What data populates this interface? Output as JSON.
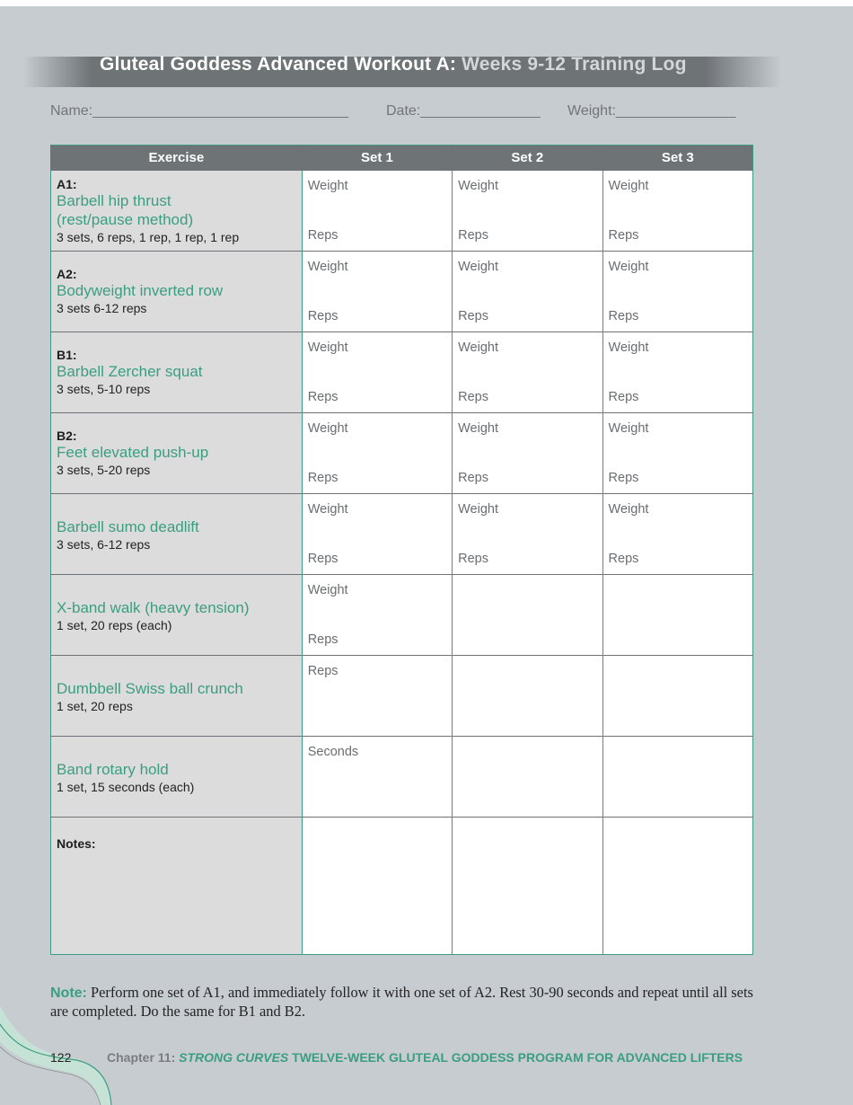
{
  "header": {
    "title_bold": "Gluteal Goddess Advanced",
    "title_mid": " Workout A:",
    "title_light": " Weeks 9-12 Training Log"
  },
  "fields": {
    "name": "Name:________________________________",
    "date": "Date:_______________",
    "weight": "Weight:_______________"
  },
  "table": {
    "headers": [
      "Exercise",
      "Set 1",
      "Set 2",
      "Set 3"
    ],
    "rows": [
      {
        "code": "A1:",
        "name": "Barbell hip thrust (rest/pause method)",
        "scheme": "3 sets, 6 reps, 1 rep, 1 rep, 1 rep",
        "cells": [
          {
            "top": "Weight",
            "bottom": "Reps"
          },
          {
            "top": "Weight",
            "bottom": "Reps"
          },
          {
            "top": "Weight",
            "bottom": "Reps"
          }
        ]
      },
      {
        "code": "A2:",
        "name": "Bodyweight inverted row",
        "scheme": "3 sets 6-12 reps",
        "cells": [
          {
            "top": "Weight",
            "bottom": "Reps"
          },
          {
            "top": "Weight",
            "bottom": "Reps"
          },
          {
            "top": "Weight",
            "bottom": "Reps"
          }
        ]
      },
      {
        "code": "B1:",
        "name": "Barbell Zercher squat",
        "scheme": "3 sets, 5-10 reps",
        "cells": [
          {
            "top": "Weight",
            "bottom": "Reps"
          },
          {
            "top": "Weight",
            "bottom": "Reps"
          },
          {
            "top": "Weight",
            "bottom": "Reps"
          }
        ]
      },
      {
        "code": "B2:",
        "name": "Feet elevated push-up",
        "scheme": "3 sets, 5-20 reps",
        "cells": [
          {
            "top": "Weight",
            "bottom": "Reps"
          },
          {
            "top": "Weight",
            "bottom": "Reps"
          },
          {
            "top": "Weight",
            "bottom": "Reps"
          }
        ]
      },
      {
        "code": "",
        "name": "Barbell sumo deadlift",
        "scheme": "3 sets, 6-12 reps",
        "cells": [
          {
            "top": "Weight",
            "bottom": "Reps"
          },
          {
            "top": "Weight",
            "bottom": "Reps"
          },
          {
            "top": "Weight",
            "bottom": "Reps"
          }
        ]
      },
      {
        "code": "",
        "name": "X-band walk (heavy tension)",
        "scheme": "1 set, 20 reps (each)",
        "cells": [
          {
            "top": "Weight",
            "bottom": "Reps"
          },
          {
            "top": "",
            "bottom": ""
          },
          {
            "top": "",
            "bottom": ""
          }
        ]
      },
      {
        "code": "",
        "name": "Dumbbell Swiss ball crunch",
        "scheme": "1 set, 20 reps",
        "cells": [
          {
            "top": "Reps",
            "bottom": ""
          },
          {
            "top": "",
            "bottom": ""
          },
          {
            "top": "",
            "bottom": ""
          }
        ]
      },
      {
        "code": "",
        "name": "Band rotary hold",
        "scheme": "1 set, 15 seconds (each)",
        "cells": [
          {
            "top": "Seconds",
            "bottom": ""
          },
          {
            "top": "",
            "bottom": ""
          },
          {
            "top": "",
            "bottom": ""
          }
        ]
      }
    ],
    "notes_label": "Notes:"
  },
  "note": {
    "label": "Note:",
    "text": " Perform one set of A1, and immediately follow it with one set of A2. Rest 30-90 seconds and repeat until all sets are completed. Do the same for B1 and B2."
  },
  "footer": {
    "page_number": "122",
    "chapter_prefix": "Chapter 11: ",
    "chapter_italic": "STRONG CURVES",
    "chapter_rest": " TWELVE-WEEK GLUTEAL GODDESS PROGRAM FOR ADVANCED LIFTERS"
  },
  "colors": {
    "accent_green": "#3a9e80",
    "header_gray": "#6e7376",
    "page_bg": "#c7ccd0"
  }
}
